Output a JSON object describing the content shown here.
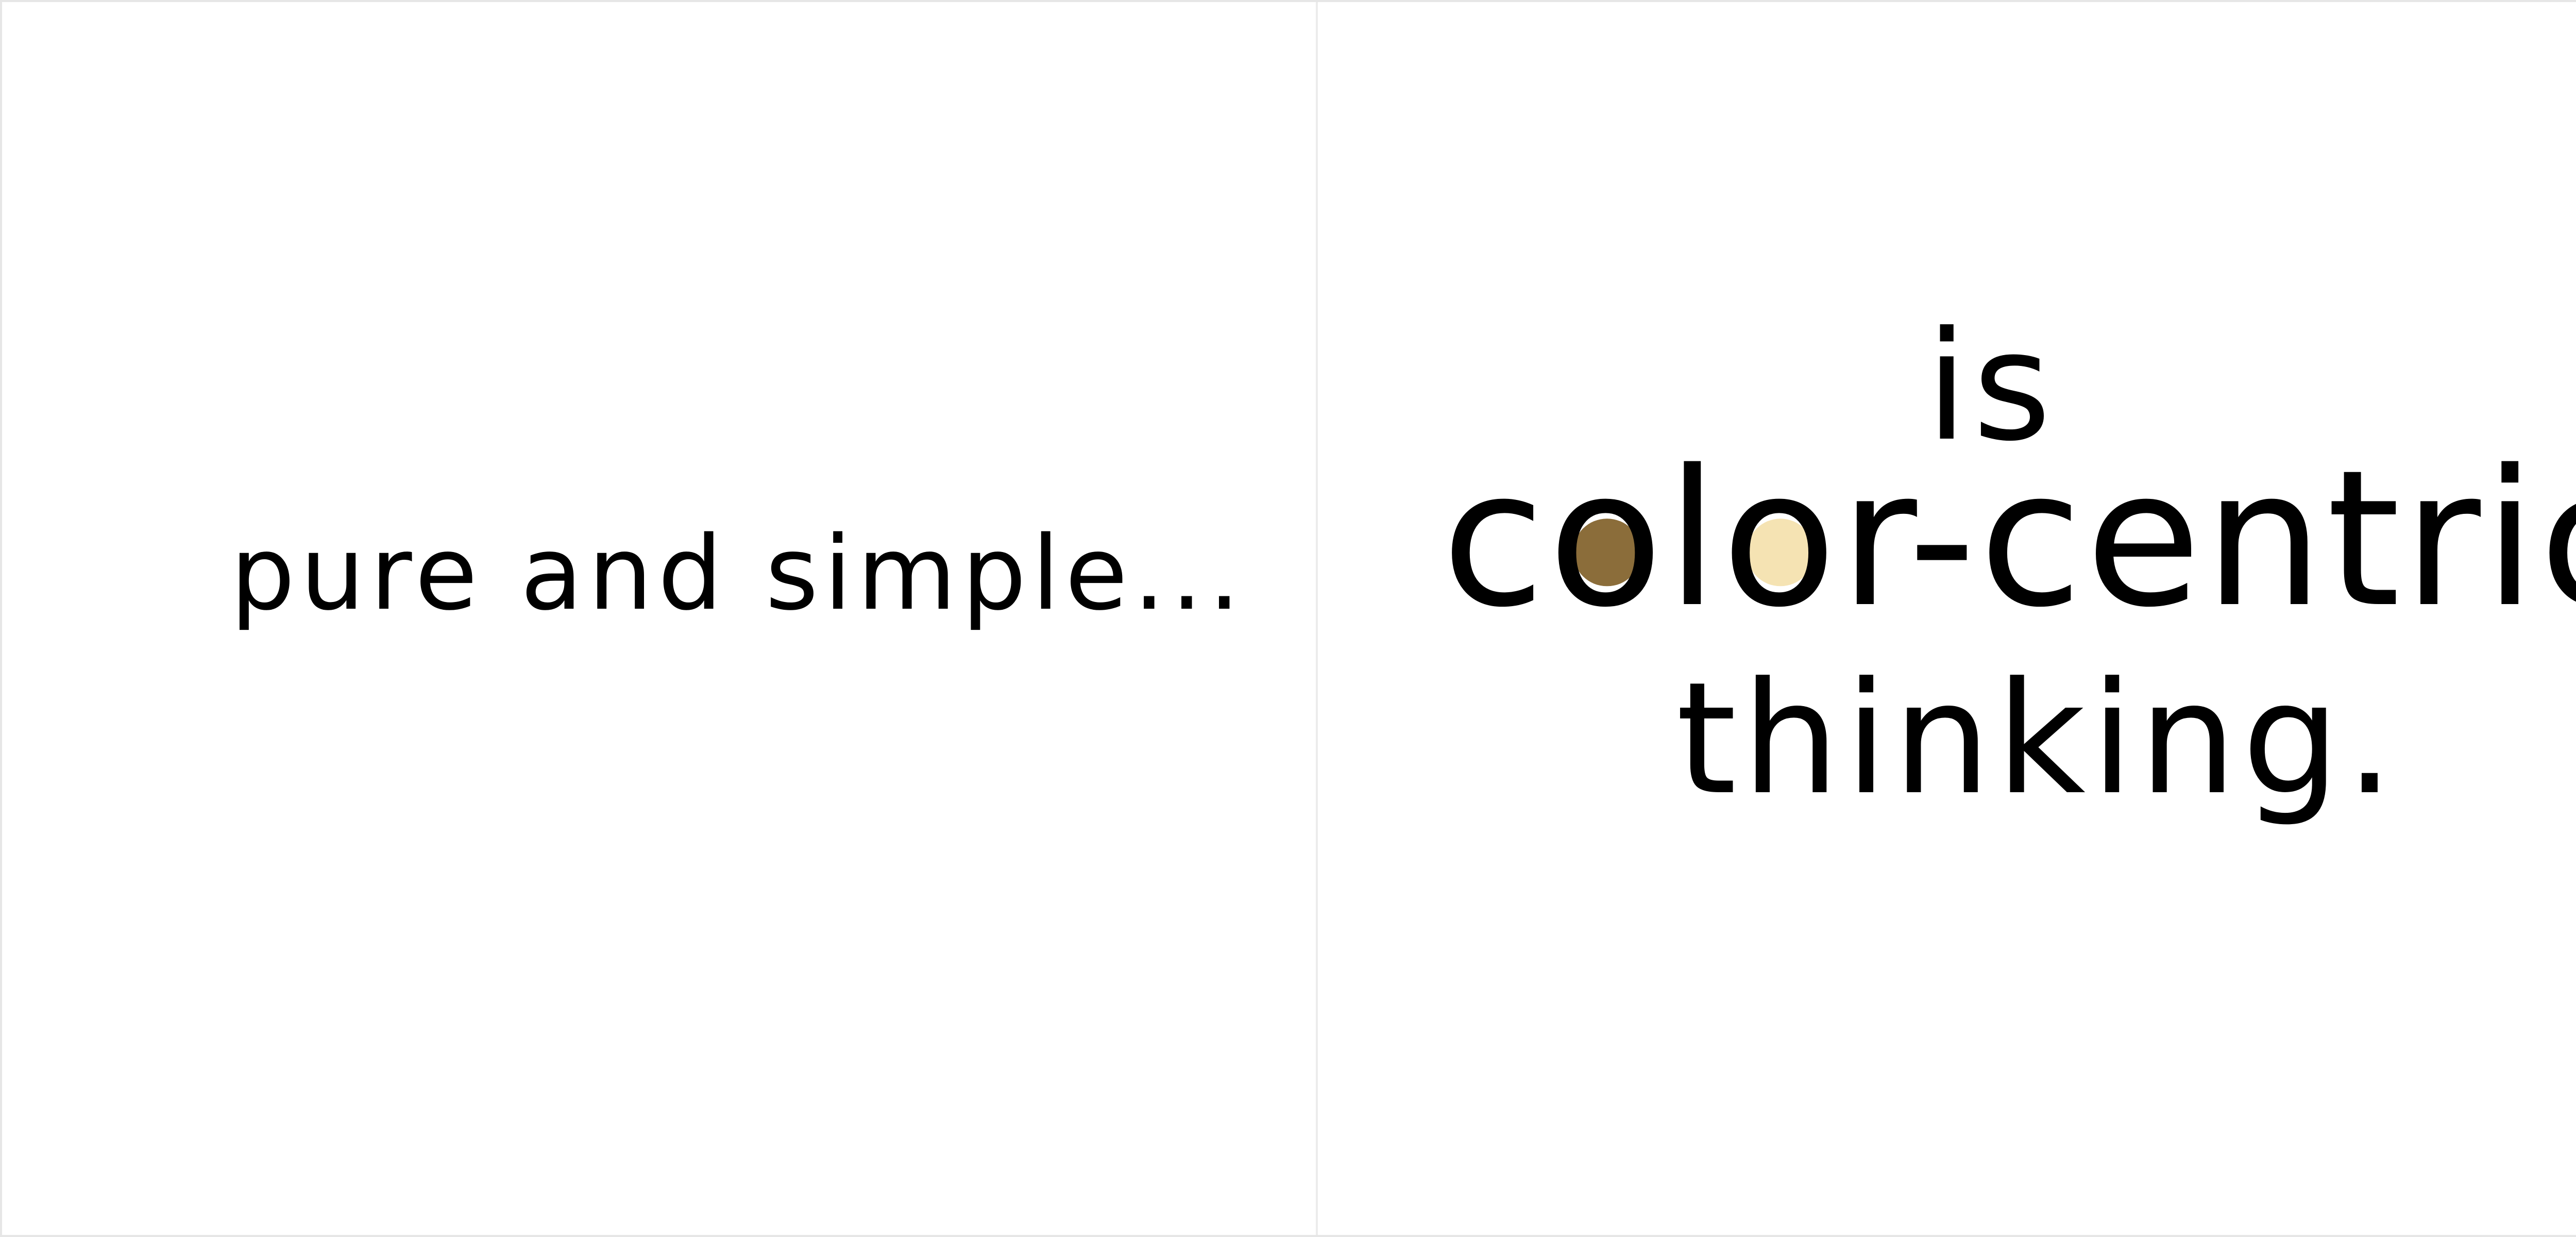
{
  "left_page": {
    "text": "pure and simple..."
  },
  "right_page": {
    "line1": "is",
    "line2": {
      "part1": "c",
      "o1": "o",
      "part2": "l",
      "o2": "o",
      "part3": "r-centric"
    },
    "line3": "thinking."
  },
  "colors": {
    "first_o_fill": "#8b6d3a",
    "second_o_fill": "#f5e3b3",
    "text": "#000000",
    "background": "#ffffff"
  }
}
